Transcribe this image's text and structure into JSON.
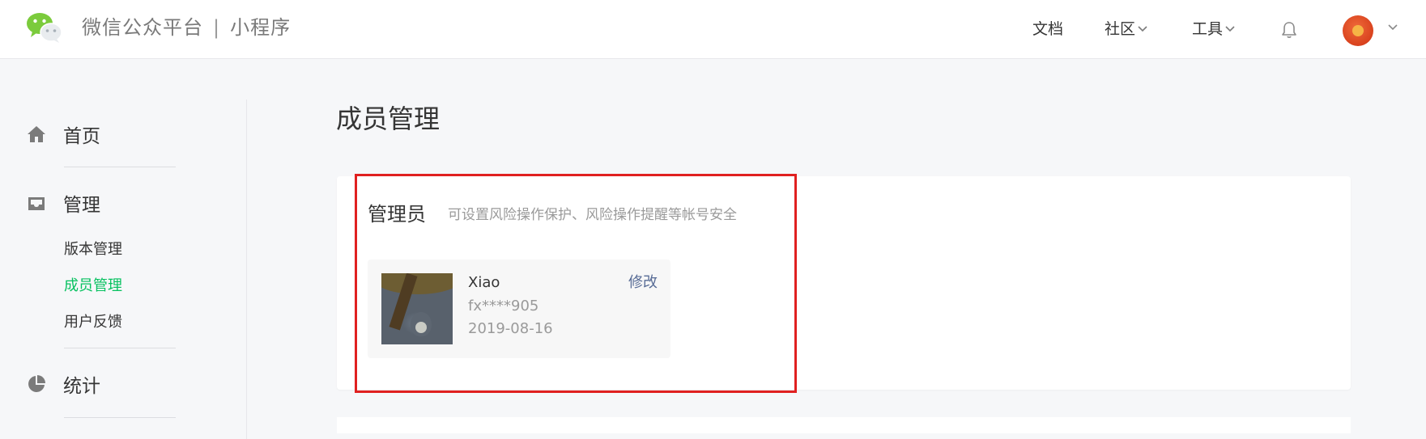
{
  "header": {
    "brand_name": "微信公众平台",
    "brand_separator": "|",
    "brand_product": "小程序",
    "nav": [
      {
        "label": "文档",
        "has_dropdown": false
      },
      {
        "label": "社区",
        "has_dropdown": true
      },
      {
        "label": "工具",
        "has_dropdown": true
      }
    ],
    "icons": {
      "logo": "wechat-logo-icon",
      "notifications": "bell-icon",
      "account_menu": "chevron-down-icon"
    }
  },
  "sidebar": {
    "sections": [
      {
        "label": "首页",
        "icon": "home-icon"
      },
      {
        "label": "管理",
        "icon": "inbox-icon",
        "items": [
          {
            "label": "版本管理",
            "active": false
          },
          {
            "label": "成员管理",
            "active": true
          },
          {
            "label": "用户反馈",
            "active": false
          }
        ]
      },
      {
        "label": "统计",
        "icon": "pie-chart-icon"
      }
    ]
  },
  "main": {
    "page_title": "成员管理",
    "admin_section": {
      "title": "管理员",
      "description": "可设置风险操作保护、风险操作提醒等帐号安全",
      "member": {
        "name": "Xiao",
        "id": "fx****905",
        "date": "2019-08-16",
        "edit_label": "修改"
      }
    }
  },
  "colors": {
    "accent_green": "#07c160",
    "link_blue": "#576b95",
    "highlight_red": "#e02020"
  }
}
